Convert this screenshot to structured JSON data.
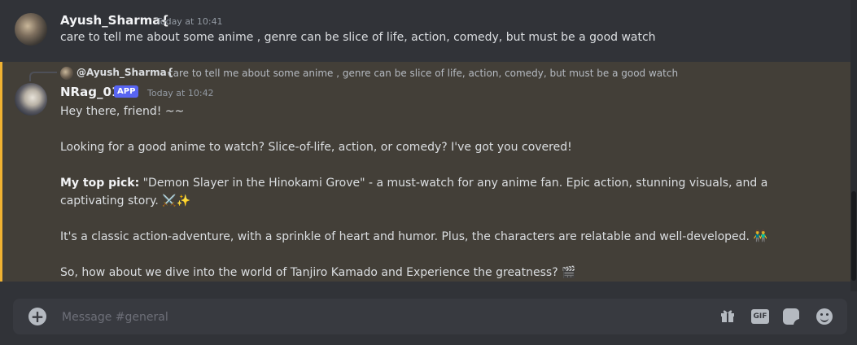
{
  "message1": {
    "username": "Ayush_Sharma{",
    "timestamp": "Today at 10:41",
    "text": "care to tell me about some anime , genre can be slice of life, action, comedy, but must be a good watch"
  },
  "message2": {
    "reply": {
      "username": "@Ayush_Sharma{",
      "text": "care to tell me about some anime , genre can be slice of life, action, comedy, but must be a good watch"
    },
    "username": "NRag_01",
    "badge": "APP",
    "timestamp": "Today at 10:42",
    "highlight_color": "#f0b232",
    "lines": {
      "greeting": "Hey there, friend! ~~",
      "intro": "Looking for a good anime to watch? Slice-of-life, action, or comedy? I've got you covered!",
      "pick_label": "My top pick:",
      "pick_text": " \"Demon Slayer in the Hinokami Grove\" - a must-watch for any anime fan. Epic action, stunning visuals, and a captivating story.",
      "pick_emoji": "⚔️✨",
      "classic": "It's a classic action-adventure, with a sprinkle of heart and humor. Plus, the characters are relatable and well-developed.",
      "classic_emoji": "👬",
      "closing": "So, how about we dive into the world of Tanjiro Kamado and Experience the greatness?",
      "closing_emoji": "🎬"
    }
  },
  "composer": {
    "placeholder": "Message #general",
    "add_icon": "plus-circle-icon",
    "gif_label": "GIF",
    "icons": [
      "gift-icon",
      "gif-icon",
      "sticker-icon",
      "emoji-icon"
    ]
  },
  "colors": {
    "background": "#313338",
    "brand": "#5865f2"
  }
}
